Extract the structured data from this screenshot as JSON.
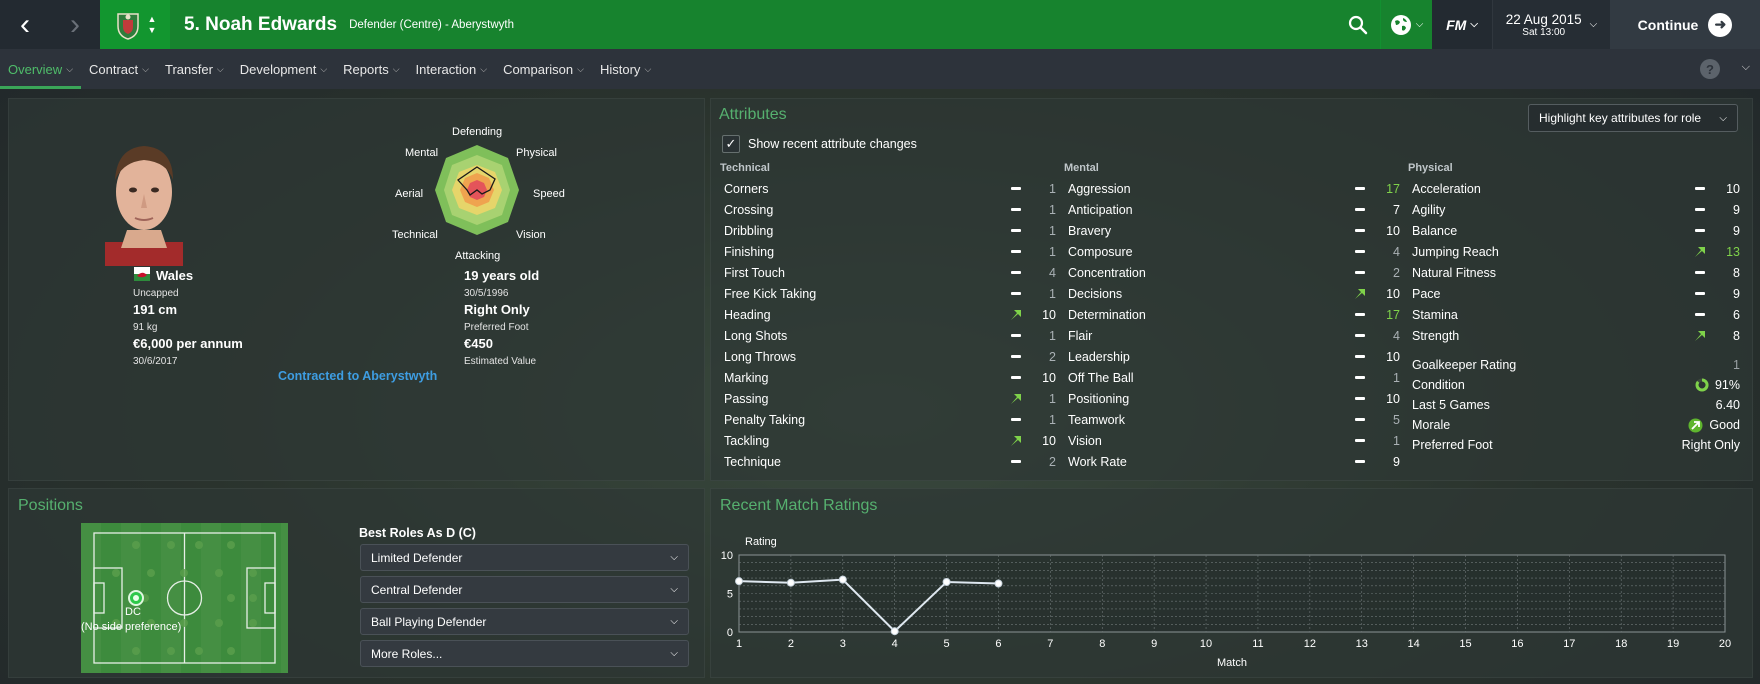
{
  "header": {
    "player_name": "5. Noah Edwards",
    "player_sub": "Defender (Centre) - Aberystwyth",
    "fm_label": "FM",
    "date": "22 Aug 2015",
    "day_time": "Sat 13:00",
    "continue_label": "Continue"
  },
  "tabs": [
    {
      "label": "Overview"
    },
    {
      "label": "Contract"
    },
    {
      "label": "Transfer"
    },
    {
      "label": "Development"
    },
    {
      "label": "Reports"
    },
    {
      "label": "Interaction"
    },
    {
      "label": "Comparison"
    },
    {
      "label": "History"
    }
  ],
  "help_label": "?",
  "profile": {
    "nation": "Wales",
    "caps": "Uncapped",
    "height": "191 cm",
    "weight": "91 kg",
    "wage": "€6,000 per annum",
    "contract_end": "30/6/2017",
    "age": "19 years old",
    "dob": "30/5/1996",
    "foot": "Right Only",
    "foot_label": "Preferred Foot",
    "value": "€450",
    "value_label": "Estimated Value",
    "contract_link": "Contracted to Aberystwyth",
    "radar_labels": {
      "defending": "Defending",
      "physical": "Physical",
      "speed": "Speed",
      "vision": "Vision",
      "attacking": "Attacking",
      "technical": "Technical",
      "aerial": "Aerial",
      "mental": "Mental"
    }
  },
  "attributes": {
    "title": "Attributes",
    "highlight_label": "Highlight key attributes for role",
    "recent_label": "Show recent attribute changes",
    "technical_head": "Technical",
    "mental_head": "Mental",
    "physical_head": "Physical",
    "technical": [
      {
        "name": "Corners",
        "value": "1",
        "trend": "flat"
      },
      {
        "name": "Crossing",
        "value": "1",
        "trend": "flat"
      },
      {
        "name": "Dribbling",
        "value": "1",
        "trend": "flat"
      },
      {
        "name": "Finishing",
        "value": "1",
        "trend": "flat"
      },
      {
        "name": "First Touch",
        "value": "4",
        "trend": "flat"
      },
      {
        "name": "Free Kick Taking",
        "value": "1",
        "trend": "flat"
      },
      {
        "name": "Heading",
        "value": "10",
        "trend": "up"
      },
      {
        "name": "Long Shots",
        "value": "1",
        "trend": "flat"
      },
      {
        "name": "Long Throws",
        "value": "2",
        "trend": "flat"
      },
      {
        "name": "Marking",
        "value": "10",
        "trend": "flat"
      },
      {
        "name": "Passing",
        "value": "1",
        "trend": "up"
      },
      {
        "name": "Penalty Taking",
        "value": "1",
        "trend": "flat"
      },
      {
        "name": "Tackling",
        "value": "10",
        "trend": "up"
      },
      {
        "name": "Technique",
        "value": "2",
        "trend": "flat"
      }
    ],
    "mental": [
      {
        "name": "Aggression",
        "value": "17",
        "trend": "flat"
      },
      {
        "name": "Anticipation",
        "value": "7",
        "trend": "flat"
      },
      {
        "name": "Bravery",
        "value": "10",
        "trend": "flat"
      },
      {
        "name": "Composure",
        "value": "4",
        "trend": "flat"
      },
      {
        "name": "Concentration",
        "value": "2",
        "trend": "flat"
      },
      {
        "name": "Decisions",
        "value": "10",
        "trend": "up"
      },
      {
        "name": "Determination",
        "value": "17",
        "trend": "flat"
      },
      {
        "name": "Flair",
        "value": "4",
        "trend": "flat"
      },
      {
        "name": "Leadership",
        "value": "10",
        "trend": "flat"
      },
      {
        "name": "Off The Ball",
        "value": "1",
        "trend": "flat"
      },
      {
        "name": "Positioning",
        "value": "10",
        "trend": "flat"
      },
      {
        "name": "Teamwork",
        "value": "5",
        "trend": "flat"
      },
      {
        "name": "Vision",
        "value": "1",
        "trend": "flat"
      },
      {
        "name": "Work Rate",
        "value": "9",
        "trend": "flat"
      }
    ],
    "physical": [
      {
        "name": "Acceleration",
        "value": "10",
        "trend": "flat"
      },
      {
        "name": "Agility",
        "value": "9",
        "trend": "flat"
      },
      {
        "name": "Balance",
        "value": "9",
        "trend": "flat"
      },
      {
        "name": "Jumping Reach",
        "value": "13",
        "trend": "up"
      },
      {
        "name": "Natural Fitness",
        "value": "8",
        "trend": "flat"
      },
      {
        "name": "Pace",
        "value": "9",
        "trend": "flat"
      },
      {
        "name": "Stamina",
        "value": "6",
        "trend": "flat"
      },
      {
        "name": "Strength",
        "value": "8",
        "trend": "up"
      }
    ],
    "extra": [
      {
        "name": "Goalkeeper Rating",
        "value": "1"
      },
      {
        "name": "Condition",
        "value": "91%"
      },
      {
        "name": "Last 5 Games",
        "value": "6.40"
      },
      {
        "name": "Morale",
        "value": "Good"
      },
      {
        "name": "Preferred Foot",
        "value": "Right Only"
      }
    ]
  },
  "positions": {
    "title": "Positions",
    "pos_code": "DC",
    "pos_note": "(No side preference)",
    "best_roles_title": "Best Roles As D (C)",
    "roles": [
      "Limited Defender",
      "Central Defender",
      "Ball Playing Defender",
      "More Roles..."
    ]
  },
  "ratings": {
    "title": "Recent Match Ratings"
  },
  "chart_data": {
    "type": "line",
    "ylabel": "Rating",
    "xlabel": "Match",
    "ylim": [
      0,
      10
    ],
    "yticks": [
      0,
      5,
      10
    ],
    "x": [
      1,
      2,
      3,
      4,
      5,
      6,
      7,
      8,
      9,
      10,
      11,
      12,
      13,
      14,
      15,
      16,
      17,
      18,
      19,
      20
    ],
    "series": [
      {
        "values": [
          6.6,
          6.4,
          6.8,
          0.1,
          6.5,
          6.3
        ]
      }
    ],
    "grid": true,
    "line_color": "#dfe8f0"
  },
  "colors": {
    "accent_green": "#3aa558",
    "header_green": "#17832e",
    "link_blue": "#3e9de2",
    "up_green": "#7fd24a"
  }
}
